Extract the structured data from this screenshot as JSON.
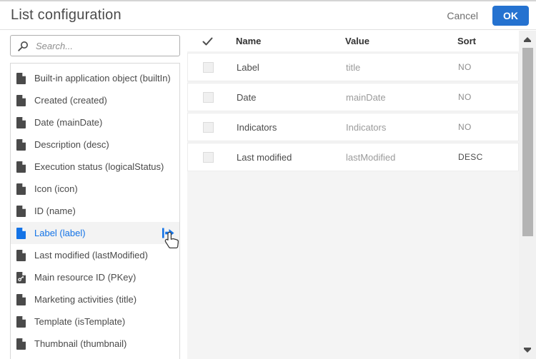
{
  "header": {
    "title": "List configuration",
    "cancel_label": "Cancel",
    "ok_label": "OK"
  },
  "search": {
    "placeholder": "Search..."
  },
  "field_list": {
    "items": [
      {
        "label": "Built-in application object (builtIn)",
        "icon": "document",
        "selected": false
      },
      {
        "label": "Created (created)",
        "icon": "document",
        "selected": false
      },
      {
        "label": "Date (mainDate)",
        "icon": "document",
        "selected": false
      },
      {
        "label": "Description (desc)",
        "icon": "document",
        "selected": false
      },
      {
        "label": "Execution status (logicalStatus)",
        "icon": "document",
        "selected": false
      },
      {
        "label": "Icon (icon)",
        "icon": "document",
        "selected": false
      },
      {
        "label": "ID (name)",
        "icon": "document",
        "selected": false
      },
      {
        "label": "Label (label)",
        "icon": "document",
        "selected": true
      },
      {
        "label": "Last modified (lastModified)",
        "icon": "document",
        "selected": false
      },
      {
        "label": "Main resource ID (PKey)",
        "icon": "document-key",
        "selected": false
      },
      {
        "label": "Marketing activities (title)",
        "icon": "document",
        "selected": false
      },
      {
        "label": "Template (isTemplate)",
        "icon": "document",
        "selected": false
      },
      {
        "label": "Thumbnail (thumbnail)",
        "icon": "document",
        "selected": false
      }
    ]
  },
  "table": {
    "columns": {
      "name": "Name",
      "value": "Value",
      "sort": "Sort"
    },
    "rows": [
      {
        "name": "Label",
        "value": "title",
        "sort": "NO",
        "checked": false
      },
      {
        "name": "Date",
        "value": "mainDate",
        "sort": "NO",
        "checked": false
      },
      {
        "name": "Indicators",
        "value": "Indicators",
        "sort": "NO",
        "checked": false
      },
      {
        "name": "Last modified",
        "value": "lastModified",
        "sort": "DESC",
        "checked": false
      }
    ]
  },
  "icons": {
    "search_icon": "magnifier",
    "field_icon": "page-with-folded-corner",
    "pkey_icon": "page-with-key",
    "selected_action_icon": "move-right-arrow",
    "header_select_icon": "checkmark",
    "row_drag_icon": "drag-dots-2x4",
    "scrollbar_icons": "triangle-up-down",
    "cursor": "hand-pointer"
  },
  "colors": {
    "accent_blue": "#1473e6",
    "ok_button_blue": "#2572d0",
    "panel_gray": "#f4f4f4",
    "selected_row_gray": "#f3f3f3"
  }
}
